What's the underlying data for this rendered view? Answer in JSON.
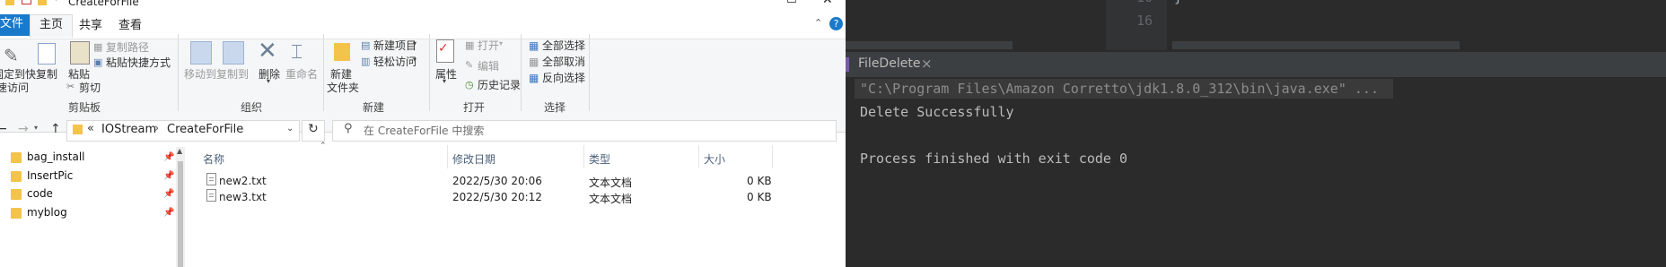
{
  "explorer": {
    "window_title": "CreateForFile",
    "window_controls": {
      "minimize": "—",
      "maximize": "☐",
      "close": "✕"
    },
    "menu": {
      "file": "文件",
      "home": "主页",
      "share": "共享",
      "view": "查看"
    },
    "help": "?",
    "ribbon": {
      "pin_line1": "固定到快",
      "pin_line2": "速访问",
      "copy": "复制",
      "paste": "粘贴",
      "copy_path": "复制路径",
      "paste_shortcut": "粘贴快捷方式",
      "cut": "剪切",
      "clipboard_group": "剪贴板",
      "move_to": "移动到",
      "copy_to": "复制到",
      "delete": "删除",
      "rename": "重命名",
      "organize_group": "组织",
      "new_folder_line1": "新建",
      "new_folder_line2": "文件夹",
      "new_item": "新建项目",
      "easy_access": "轻松访问",
      "new_group": "新建",
      "properties": "属性",
      "open": "打开",
      "edit": "编辑",
      "history": "历史记录",
      "open_group": "打开",
      "select_all": "全部选择",
      "select_none": "全部取消",
      "invert_selection": "反向选择",
      "select_group": "选择"
    },
    "address": {
      "overflow": "«",
      "crumbs": [
        "IOStream",
        "CreateForFile"
      ],
      "separator": "›"
    },
    "search": {
      "placeholder": "在 CreateForFile 中搜索"
    },
    "nav_items": [
      {
        "label": "bag_install"
      },
      {
        "label": "InsertPic"
      },
      {
        "label": "code"
      },
      {
        "label": "myblog"
      }
    ],
    "columns": {
      "name": "名称",
      "date": "修改日期",
      "type": "类型",
      "size": "大小"
    },
    "files": [
      {
        "name": "new2.txt",
        "date": "2022/5/30 20:06",
        "type": "文本文档",
        "size": "0 KB"
      },
      {
        "name": "new3.txt",
        "date": "2022/5/30 20:12",
        "type": "文本文档",
        "size": "0 KB"
      }
    ]
  },
  "ide": {
    "line_number": "16",
    "line_number_partial": "16",
    "code_fragment": "}",
    "run_tab": "FileDelete",
    "run_tab_close": "×",
    "console_lines": [
      "\"C:\\Program Files\\Amazon Corretto\\jdk1.8.0_312\\bin\\java.exe\" ...",
      "Delete Successfully",
      "",
      "Process finished with exit code 0"
    ]
  },
  "colors": {
    "accent": "#1979ca",
    "console_bg": "#2b2b2b",
    "console_text": "#bbbbbb",
    "command_line_bg": "#3a3a3a"
  }
}
